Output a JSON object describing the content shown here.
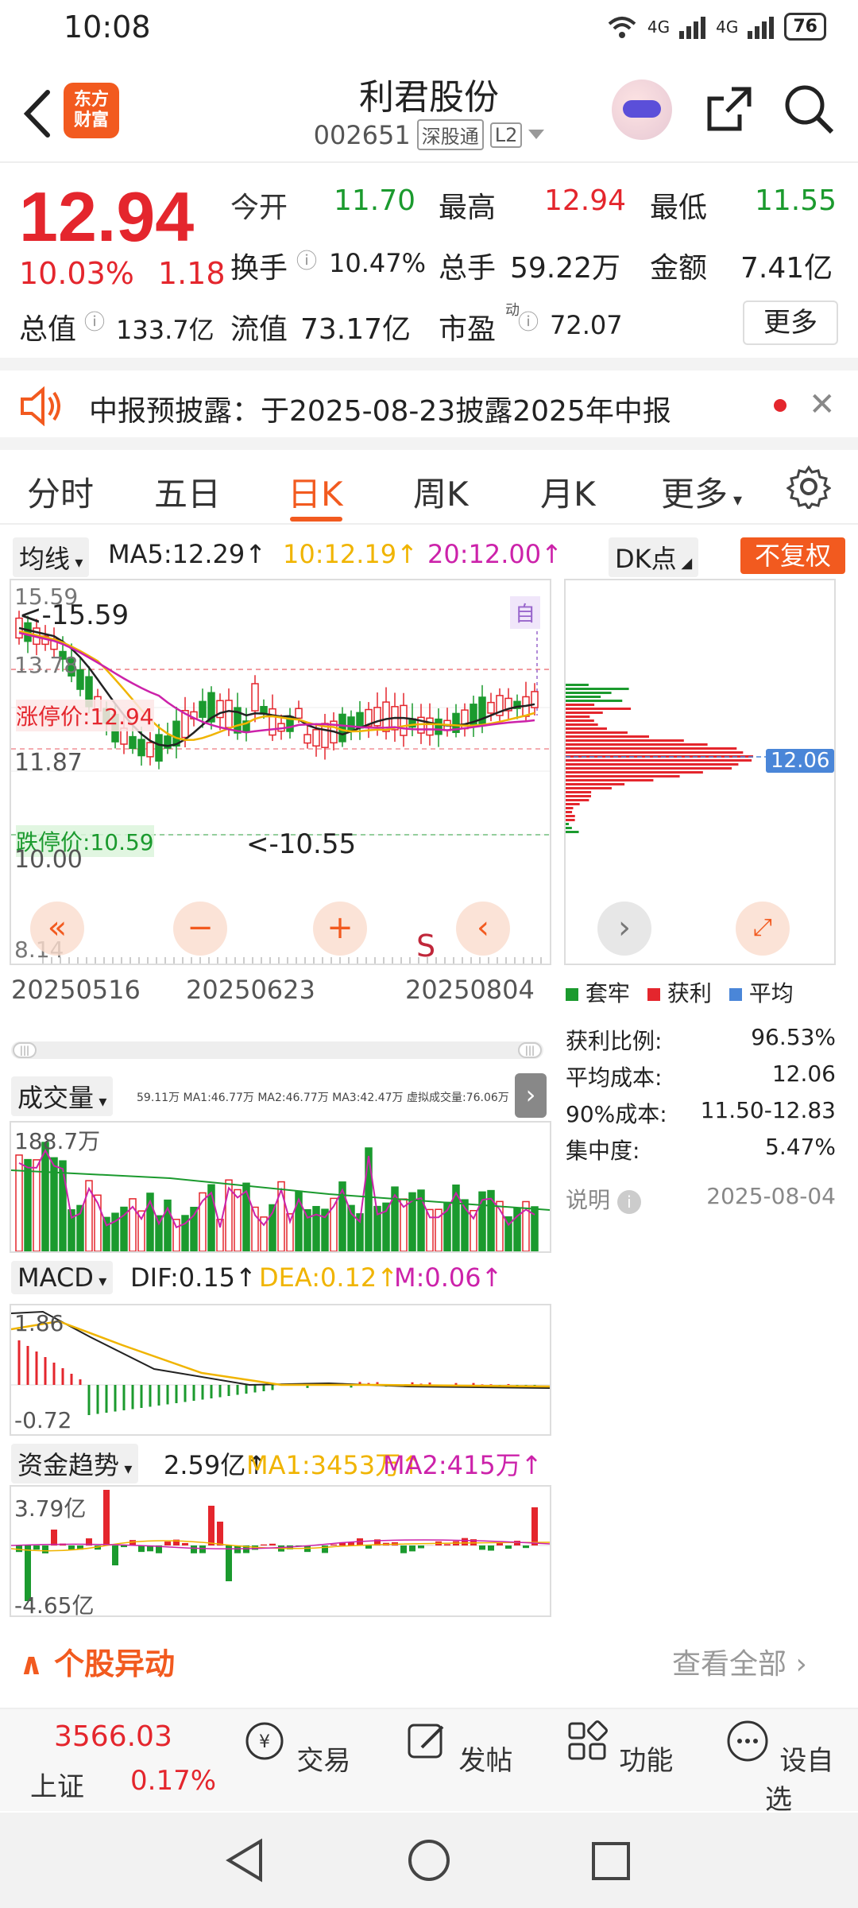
{
  "status_bar": {
    "time": "10:08",
    "network1": "4G",
    "network2": "4G",
    "battery": "76"
  },
  "header": {
    "logo_line1": "东方",
    "logo_line2": "财富",
    "stock_name": "利君股份",
    "stock_code": "002651",
    "tag1": "深股通",
    "tag2": "L2"
  },
  "quote": {
    "price": "12.94",
    "change_pct": "10.03%",
    "change_amt": "1.18",
    "open_label": "今开",
    "open": "11.70",
    "high_label": "最高",
    "high": "12.94",
    "low_label": "最低",
    "low": "11.55",
    "turnover_label": "换手",
    "turnover": "10.47%",
    "volume_label": "总手",
    "volume": "59.22万",
    "amount_label": "金额",
    "amount": "7.41亿",
    "total_mv_label": "总值",
    "total_mv": "133.7亿",
    "float_mv_label": "流值",
    "float_mv": "73.17亿",
    "pe_label": "市盈",
    "pe_sup": "动",
    "pe": "72.07",
    "more_label": "更多"
  },
  "notice": {
    "text": "中报预披露：于2025-08-23披露2025年中报"
  },
  "tabs": [
    "分时",
    "五日",
    "日K",
    "周K",
    "月K",
    "更多"
  ],
  "active_tab": "日K",
  "kline": {
    "indicator": "均线",
    "ma5": "MA5:12.29↑",
    "ma10": "10:12.19↑",
    "ma20": "20:12.00↑",
    "dk_label": "DK点",
    "adjust_label": "不复权",
    "high_label": "15.59",
    "high_marker": "<-15.59",
    "y_1378": "13.78",
    "limit_up": "涨停价:12.94",
    "y_1187": "11.87",
    "limit_down": "跌停价:10.59",
    "y_1000": "10.00",
    "low_marker": "<-10.55",
    "y_814": "8.14",
    "zi": "自",
    "s_mark": "S",
    "dates": [
      "20250516",
      "20250623",
      "20250804"
    ],
    "colors": {
      "up": "#e4262d",
      "down": "#1b9a2e",
      "ma5": "#222222",
      "ma10": "#f0b400",
      "ma20": "#cc22aa"
    }
  },
  "chips": {
    "avg_label": "12.06",
    "legend": [
      "套牢",
      "获利",
      "平均"
    ],
    "rows": [
      {
        "label": "获利比例:",
        "value": "96.53%"
      },
      {
        "label": "平均成本:",
        "value": "12.06"
      },
      {
        "label": "90%成本:",
        "value": "11.50-12.83"
      },
      {
        "label": "集中度:",
        "value": "5.47%"
      }
    ],
    "note_label": "说明",
    "note_date": "2025-08-04"
  },
  "volume": {
    "label": "成交量",
    "summary": "59.11万 MA1:46.77万 MA2:46.77万 MA3:42.47万 虚拟成交量:76.06万",
    "max_label": "188.7万"
  },
  "macd": {
    "label": "MACD",
    "dif": "DIF:0.15↑",
    "dea": "DEA:0.12↑",
    "m": "M:0.06↑",
    "max_label": "1.86",
    "min_label": "-0.72"
  },
  "fund": {
    "label": "资金趋势",
    "value": "2.59亿↑",
    "ma1": "MA1:3453万↑",
    "ma2": "MA2:415万↑",
    "max_label": "3.79亿",
    "min_label": "-4.65亿"
  },
  "anomaly": {
    "title": "个股异动",
    "view_all": "查看全部"
  },
  "bottom_nav": {
    "index_value": "3566.03",
    "index_name": "上证",
    "index_change": "0.17%",
    "items": [
      "交易",
      "发帖",
      "功能",
      "设自选"
    ]
  }
}
